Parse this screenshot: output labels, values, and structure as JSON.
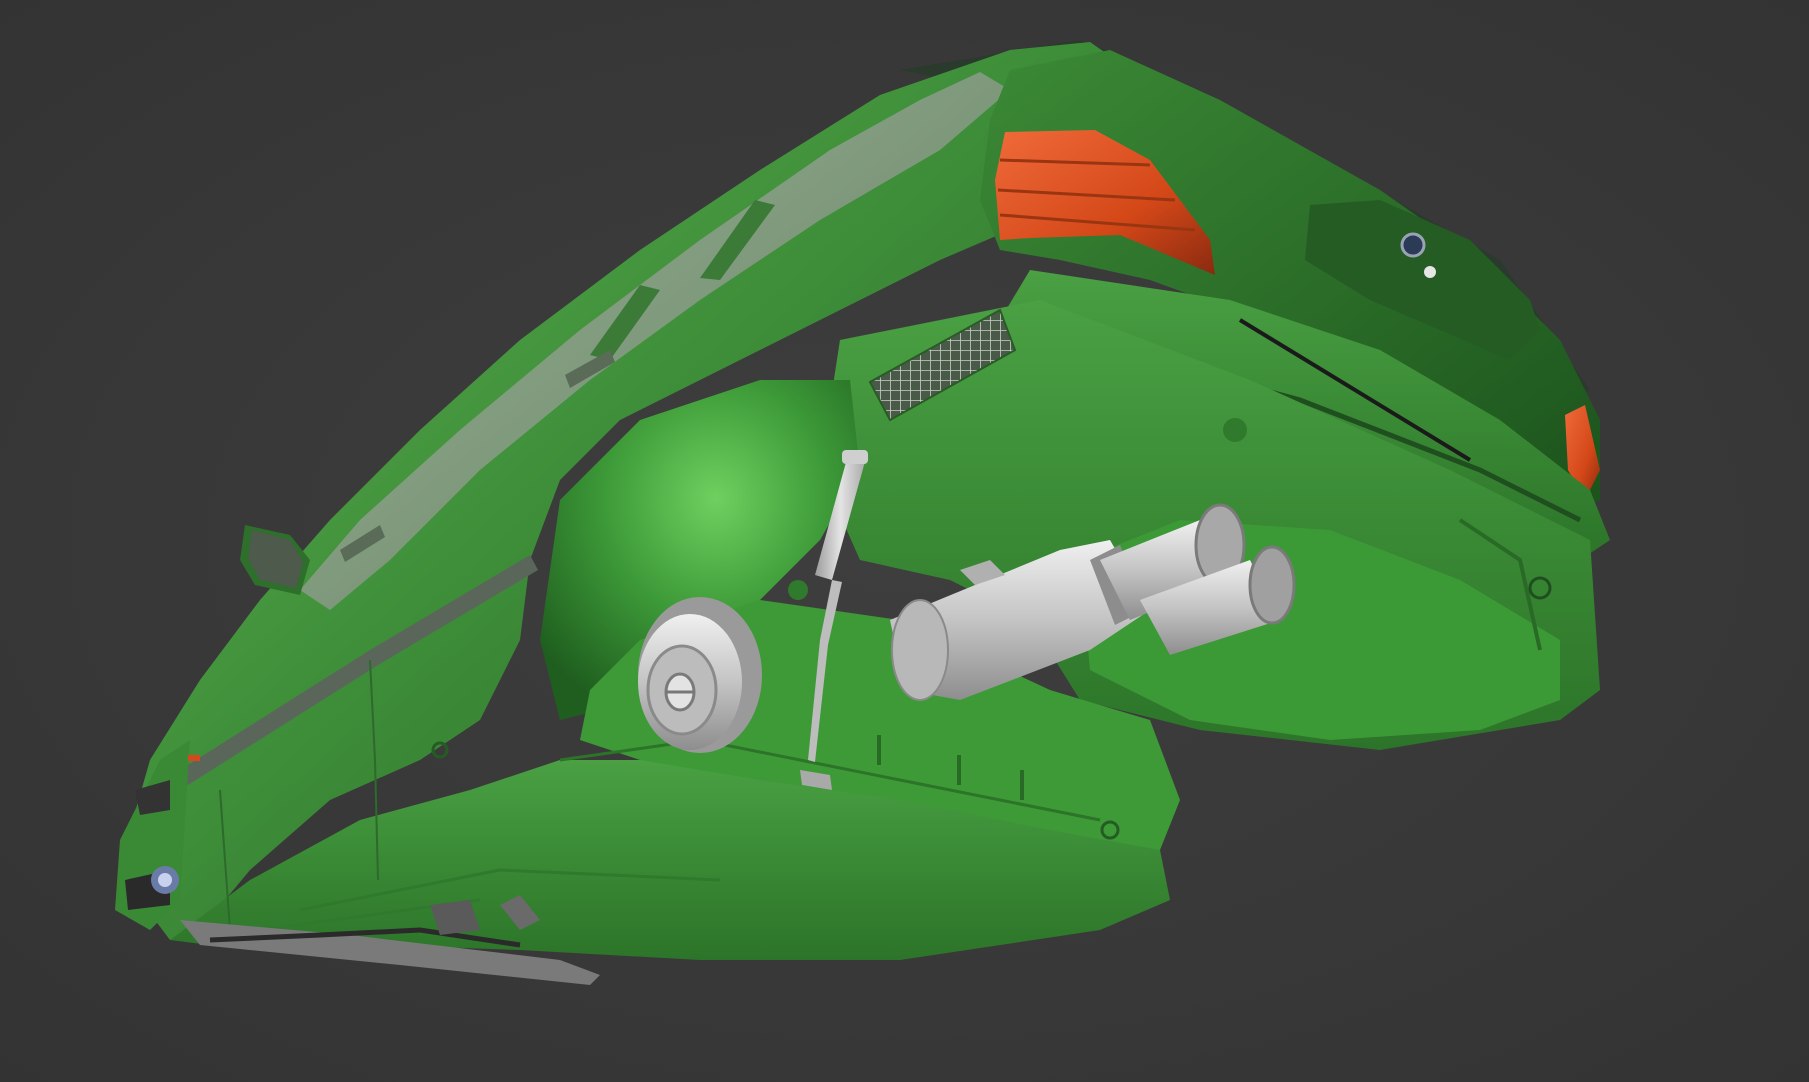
{
  "viewport": {
    "background": "#3a3a3a",
    "model": {
      "type": "car-underside-render",
      "paint_color": "#3f8f3a",
      "paint_dark": "#1f5a22",
      "paint_light": "#6cc25c",
      "taillight_color": "#d8481c",
      "chrome_color": "#c9c9c9",
      "glass_color": "#8a9a88",
      "icons": [
        "car-body",
        "tail-light",
        "exhaust-pipe",
        "spare-wheel",
        "gas-strut",
        "side-mirror",
        "rear-bumper",
        "license-light",
        "badge-logo"
      ]
    }
  }
}
